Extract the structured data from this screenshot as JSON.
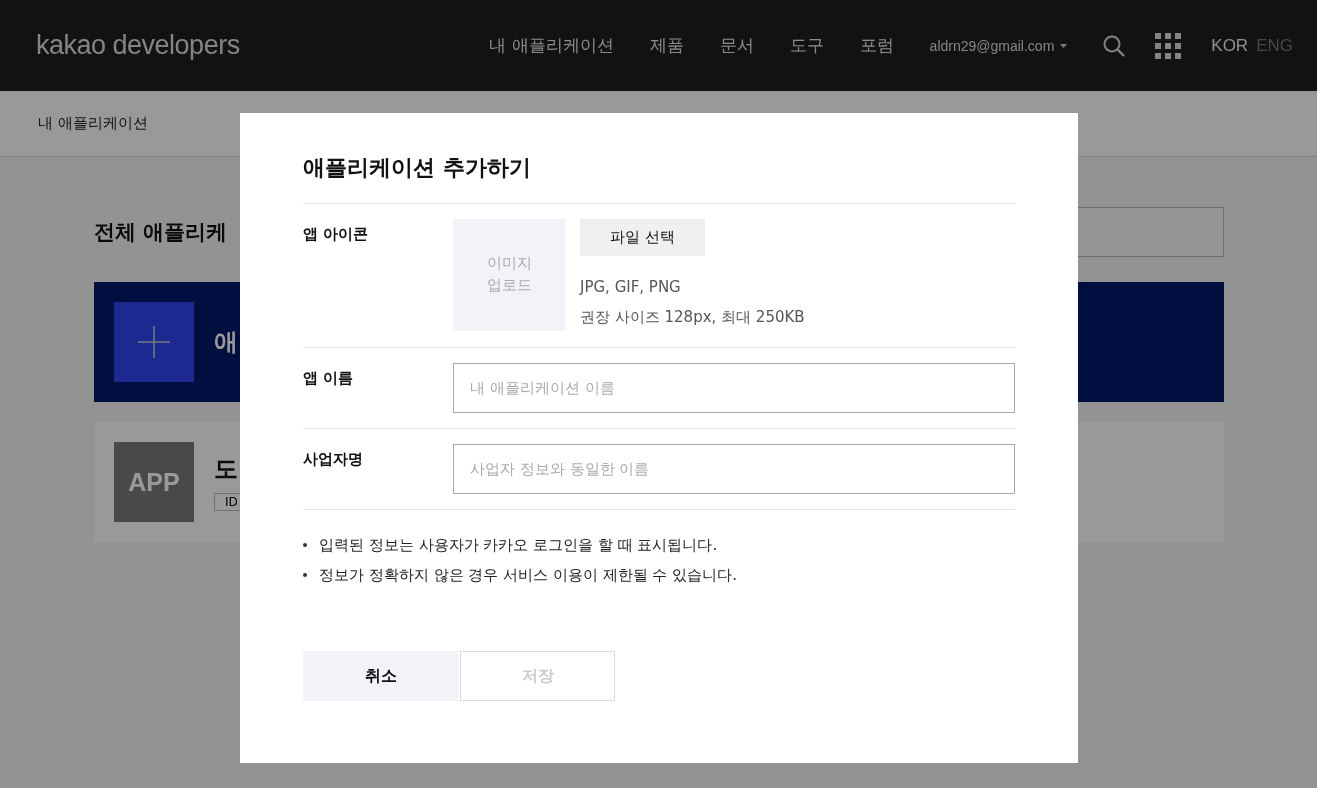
{
  "header": {
    "logo": "kakao developers",
    "nav": [
      "내 애플리케이션",
      "제품",
      "문서",
      "도구",
      "포럼"
    ],
    "account": "aldrn29@gmail.com",
    "languages": [
      {
        "label": "KOR",
        "selected": true
      },
      {
        "label": "ENG",
        "selected": false
      }
    ]
  },
  "page": {
    "breadcrumb": "내 애플리케이션",
    "title": "전체 애플리케",
    "add_card": {
      "label": "애"
    },
    "app_card": {
      "icon_text": "APP",
      "name": "도",
      "id_label": "ID"
    }
  },
  "dialog": {
    "title": "애플리케이션 추가하기",
    "rows": [
      {
        "kind": "icon",
        "label": "앱 아이콘",
        "upload_text": "이미지\n업로드",
        "button": "파일 선택",
        "hints": [
          "JPG, GIF, PNG",
          "권장 사이즈 128px, 최대 250KB"
        ]
      },
      {
        "kind": "input",
        "label": "앱 이름",
        "placeholder": "내 애플리케이션 이름"
      },
      {
        "kind": "input",
        "label": "사업자명",
        "placeholder": "사업자 정보와 동일한 이름"
      }
    ],
    "notes": [
      "입력된 정보는 사용자가 카카오 로그인을 할 때 표시됩니다.",
      "정보가 정확하지 않은 경우 서비스 이용이 제한될 수 있습니다."
    ],
    "buttons": [
      {
        "label": "취소",
        "disabled": false
      },
      {
        "label": "저장",
        "disabled": true
      }
    ]
  }
}
